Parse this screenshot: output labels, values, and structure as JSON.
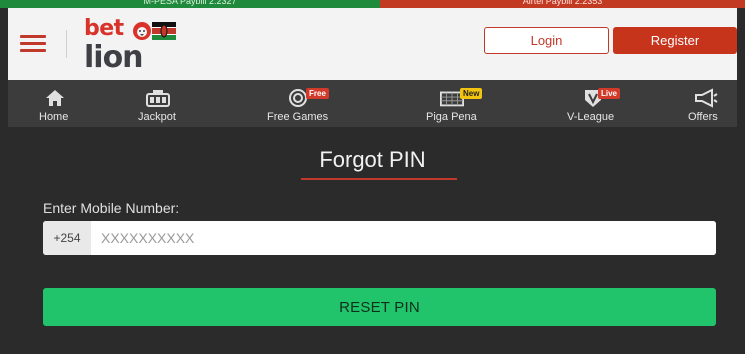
{
  "top_strip": {
    "left_text": "M-PESA Paybill 2.2327",
    "right_text": "Airtel Paybill 2.2353"
  },
  "header": {
    "logo": {
      "word_top": "bet",
      "word_bottom": "lion"
    },
    "login_label": "Login",
    "register_label": "Register"
  },
  "nav": {
    "items": [
      {
        "label": "Home",
        "icon": "home-icon"
      },
      {
        "label": "Jackpot",
        "icon": "jackpot-icon"
      },
      {
        "label": "Free Games",
        "icon": "free-games-icon",
        "badge": "Free"
      },
      {
        "label": "Piga Pena",
        "icon": "piga-pena-icon",
        "badge": "New"
      },
      {
        "label": "V-League",
        "icon": "v-league-icon",
        "badge": "Live"
      },
      {
        "label": "Offers",
        "icon": "megaphone-icon"
      }
    ]
  },
  "form": {
    "title": "Forgot PIN",
    "field_label": "Enter Mobile Number:",
    "country_code": "+254",
    "mobile_placeholder": "XXXXXXXXXX",
    "mobile_value": "",
    "submit_label": "RESET PIN"
  },
  "colors": {
    "accent_red": "#c6341c",
    "success_green": "#21c46a",
    "nav_bg": "#3c3c3c",
    "page_bg": "#2b2b2b"
  }
}
